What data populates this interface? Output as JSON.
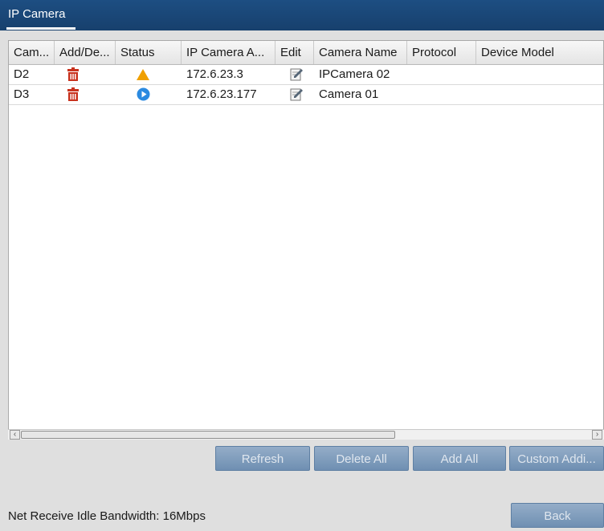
{
  "window": {
    "title": "IP Camera"
  },
  "table": {
    "columns": [
      "Cam...",
      "Add/De...",
      "Status",
      "IP Camera A...",
      "Edit",
      "Camera Name",
      "Protocol",
      "Device Model"
    ],
    "rows": [
      {
        "cam": "D2",
        "add_delete_icon": "trash-icon",
        "status_icon": "warning-icon",
        "ip": "172.6.23.3",
        "edit_icon": "edit-icon",
        "camera_name": "IPCamera 02",
        "protocol": "",
        "device_model": ""
      },
      {
        "cam": "D3",
        "add_delete_icon": "trash-icon",
        "status_icon": "play-icon",
        "ip": "172.6.23.177",
        "edit_icon": "edit-icon",
        "camera_name": "Camera 01",
        "protocol": "",
        "device_model": ""
      }
    ]
  },
  "buttons": {
    "refresh": "Refresh",
    "delete_all": "Delete All",
    "add_all": "Add All",
    "custom_add": "Custom Addi...",
    "back": "Back"
  },
  "footer": {
    "bandwidth": "Net Receive Idle Bandwidth: 16Mbps"
  },
  "colors": {
    "titlebar": "#1d4e82",
    "button": "#7f9cbd",
    "trash": "#c8321e",
    "warning": "#f0a000",
    "play": "#2b8ae0"
  }
}
